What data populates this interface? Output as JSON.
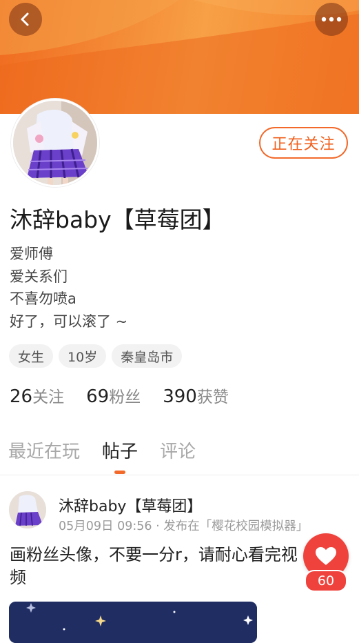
{
  "header": {
    "back_icon": "chevron-left-icon",
    "more_icon": "more-dots-icon",
    "banner_colors": [
      "#f06b1f",
      "#f7a046"
    ]
  },
  "profile": {
    "follow_label": "正在关注",
    "username": "沐辞baby【草莓团】",
    "bio": [
      "爱师傅",
      "爱关系们",
      "不喜勿喷a",
      "好了，可以滚了 ~"
    ],
    "tags": [
      "女生",
      "10岁",
      "秦皇岛市"
    ],
    "stats": [
      {
        "num": "26",
        "label": "关注"
      },
      {
        "num": "69",
        "label": "粉丝"
      },
      {
        "num": "390",
        "label": "获赞"
      }
    ]
  },
  "tabs": [
    {
      "label": "最近在玩",
      "active": false
    },
    {
      "label": "帖子",
      "active": true
    },
    {
      "label": "评论",
      "active": false
    }
  ],
  "post": {
    "author": "沐辞baby【草莓团】",
    "meta": "05月09日 09:56 · 发布在「樱花校园模拟器」",
    "text": "画粉丝头像，不要一分r，请耐心看完视频",
    "like_count": "60"
  },
  "colors": {
    "accent": "#f2692a",
    "like": "#f0423c"
  }
}
